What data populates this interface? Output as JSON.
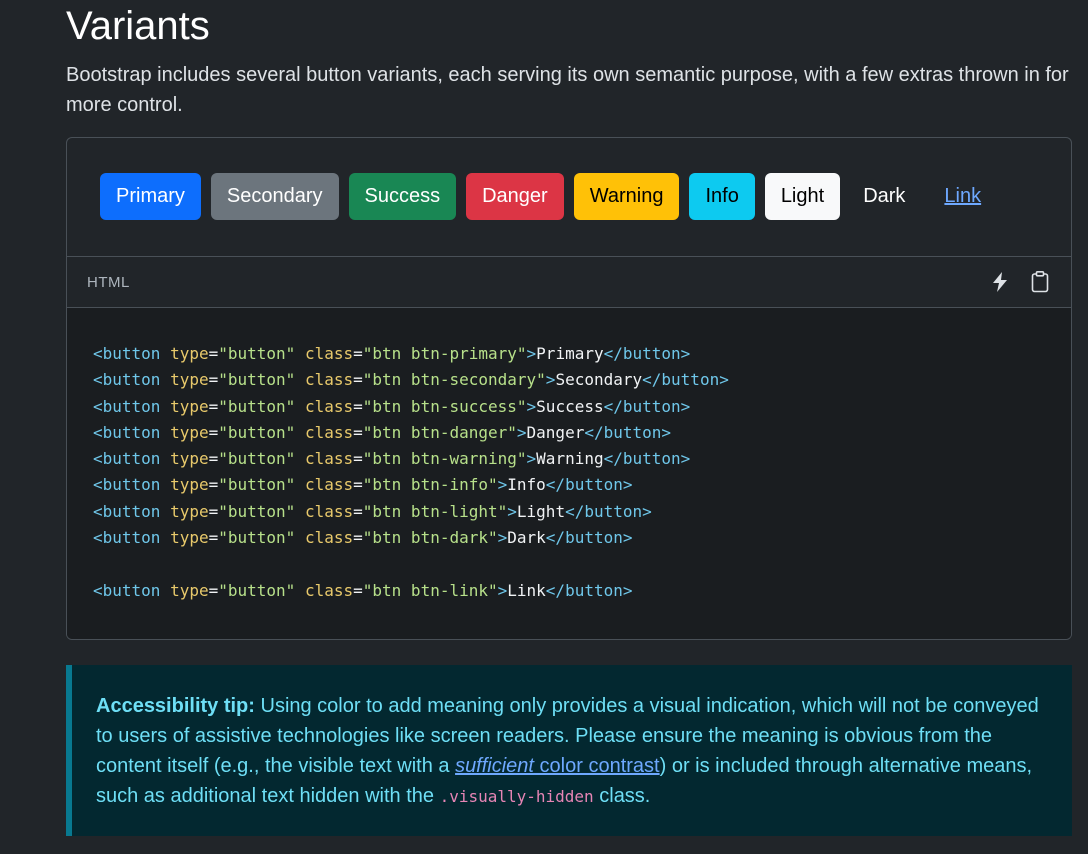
{
  "section": {
    "title": "Variants",
    "lead": "Bootstrap includes several button variants, each serving its own semantic purpose, with a few extras thrown in for more control."
  },
  "preview": {
    "buttons": [
      {
        "label": "Primary",
        "variant": "primary"
      },
      {
        "label": "Secondary",
        "variant": "secondary"
      },
      {
        "label": "Success",
        "variant": "success"
      },
      {
        "label": "Danger",
        "variant": "danger"
      },
      {
        "label": "Warning",
        "variant": "warning"
      },
      {
        "label": "Info",
        "variant": "info"
      },
      {
        "label": "Light",
        "variant": "light"
      },
      {
        "label": "Dark",
        "variant": "dark"
      },
      {
        "label": "Link",
        "variant": "link"
      }
    ]
  },
  "code": {
    "language": "HTML",
    "tools": {
      "stackblitz_icon": "lightning-icon",
      "copy_icon": "clipboard-icon"
    },
    "lines": [
      "<button type=\"button\" class=\"btn btn-primary\">Primary</button>",
      "<button type=\"button\" class=\"btn btn-secondary\">Secondary</button>",
      "<button type=\"button\" class=\"btn btn-success\">Success</button>",
      "<button type=\"button\" class=\"btn btn-danger\">Danger</button>",
      "<button type=\"button\" class=\"btn btn-warning\">Warning</button>",
      "<button type=\"button\" class=\"btn btn-info\">Info</button>",
      "<button type=\"button\" class=\"btn btn-light\">Light</button>",
      "<button type=\"button\" class=\"btn btn-dark\">Dark</button>",
      "",
      "<button type=\"button\" class=\"btn btn-link\">Link</button>"
    ]
  },
  "callout": {
    "heading": "Accessibility tip:",
    "text_before_link": " Using color to add meaning only provides a visual indication, which will not be conveyed to users of assistive technologies like screen readers. Please ensure the meaning is obvious from the content itself (e.g., the visible text with a ",
    "link_em": "sufficient",
    "link_rest": " color contrast",
    "text_after_link": ") or is included through alternative means, such as additional text hidden with the ",
    "code": ".visually-hidden",
    "text_end": " class."
  },
  "colors": {
    "background": "#212529",
    "primary": "#0d6efd",
    "secondary": "#6c757d",
    "success": "#198754",
    "danger": "#dc3545",
    "warning": "#ffc107",
    "info": "#0dcaf0",
    "light": "#f8f9fa",
    "link": "#6ea8fe",
    "callout_bg": "#032830",
    "callout_border": "#087990",
    "callout_text": "#6edff6"
  }
}
